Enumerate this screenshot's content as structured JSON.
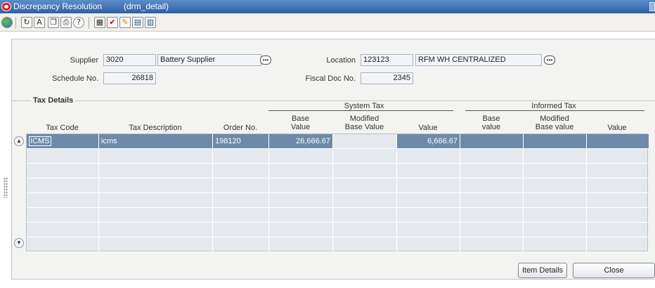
{
  "window": {
    "title": "Discrepancy Resolution",
    "form_name": "(drm_detail)",
    "icon": "oracle-o-icon"
  },
  "toolbar": {
    "icons": [
      "globe-icon",
      "refresh-icon",
      "spellcheck-icon",
      "copy-icon",
      "print-icon",
      "help-icon",
      "table-icon",
      "check-icon",
      "edit-icon",
      "calendar-icon",
      "calendar-alt-icon"
    ],
    "help_glyph": "?",
    "ab_glyph": "A"
  },
  "header": {
    "supplier_label": "Supplier",
    "supplier_code": "3020",
    "supplier_name": "Battery Supplier",
    "schedule_label": "Schedule No.",
    "schedule_value": "26818",
    "location_label": "Location",
    "location_code": "123123",
    "location_name": "RFM WH CENTRALIZED",
    "fiscal_label": "Fiscal Doc No.",
    "fiscal_value": "2345"
  },
  "tax_details": {
    "section_title": "Tax Details",
    "groups": {
      "system": "System Tax",
      "informed": "Informed Tax"
    },
    "columns": {
      "tax_code": "Tax Code",
      "tax_description": "Tax Description",
      "order_no": "Order No.",
      "sys_base_1": "Base",
      "sys_base_2": "Value",
      "sys_mod_1": "Modified",
      "sys_mod_2": "Base Value",
      "sys_value": "Value",
      "inf_base_1": "Base",
      "inf_base_2": "value",
      "inf_mod_1": "Modified",
      "inf_mod_2": "Base value",
      "inf_value": "Value"
    },
    "rows": [
      {
        "tax_code": "ICMS",
        "tax_description": "icms",
        "order_no": "198120",
        "sys_base": "26,666.67",
        "sys_mod": "",
        "sys_value": "6,666.67",
        "inf_base": "",
        "inf_mod": "",
        "inf_value": "",
        "selected": true
      }
    ],
    "empty_rows": 7
  },
  "buttons": {
    "item_details": "Item Details",
    "close": "Close"
  },
  "colors": {
    "title_bar": "#2d5fa3",
    "selected_row": "#6e8aa8",
    "grid_bg": "#e5e9ee"
  }
}
